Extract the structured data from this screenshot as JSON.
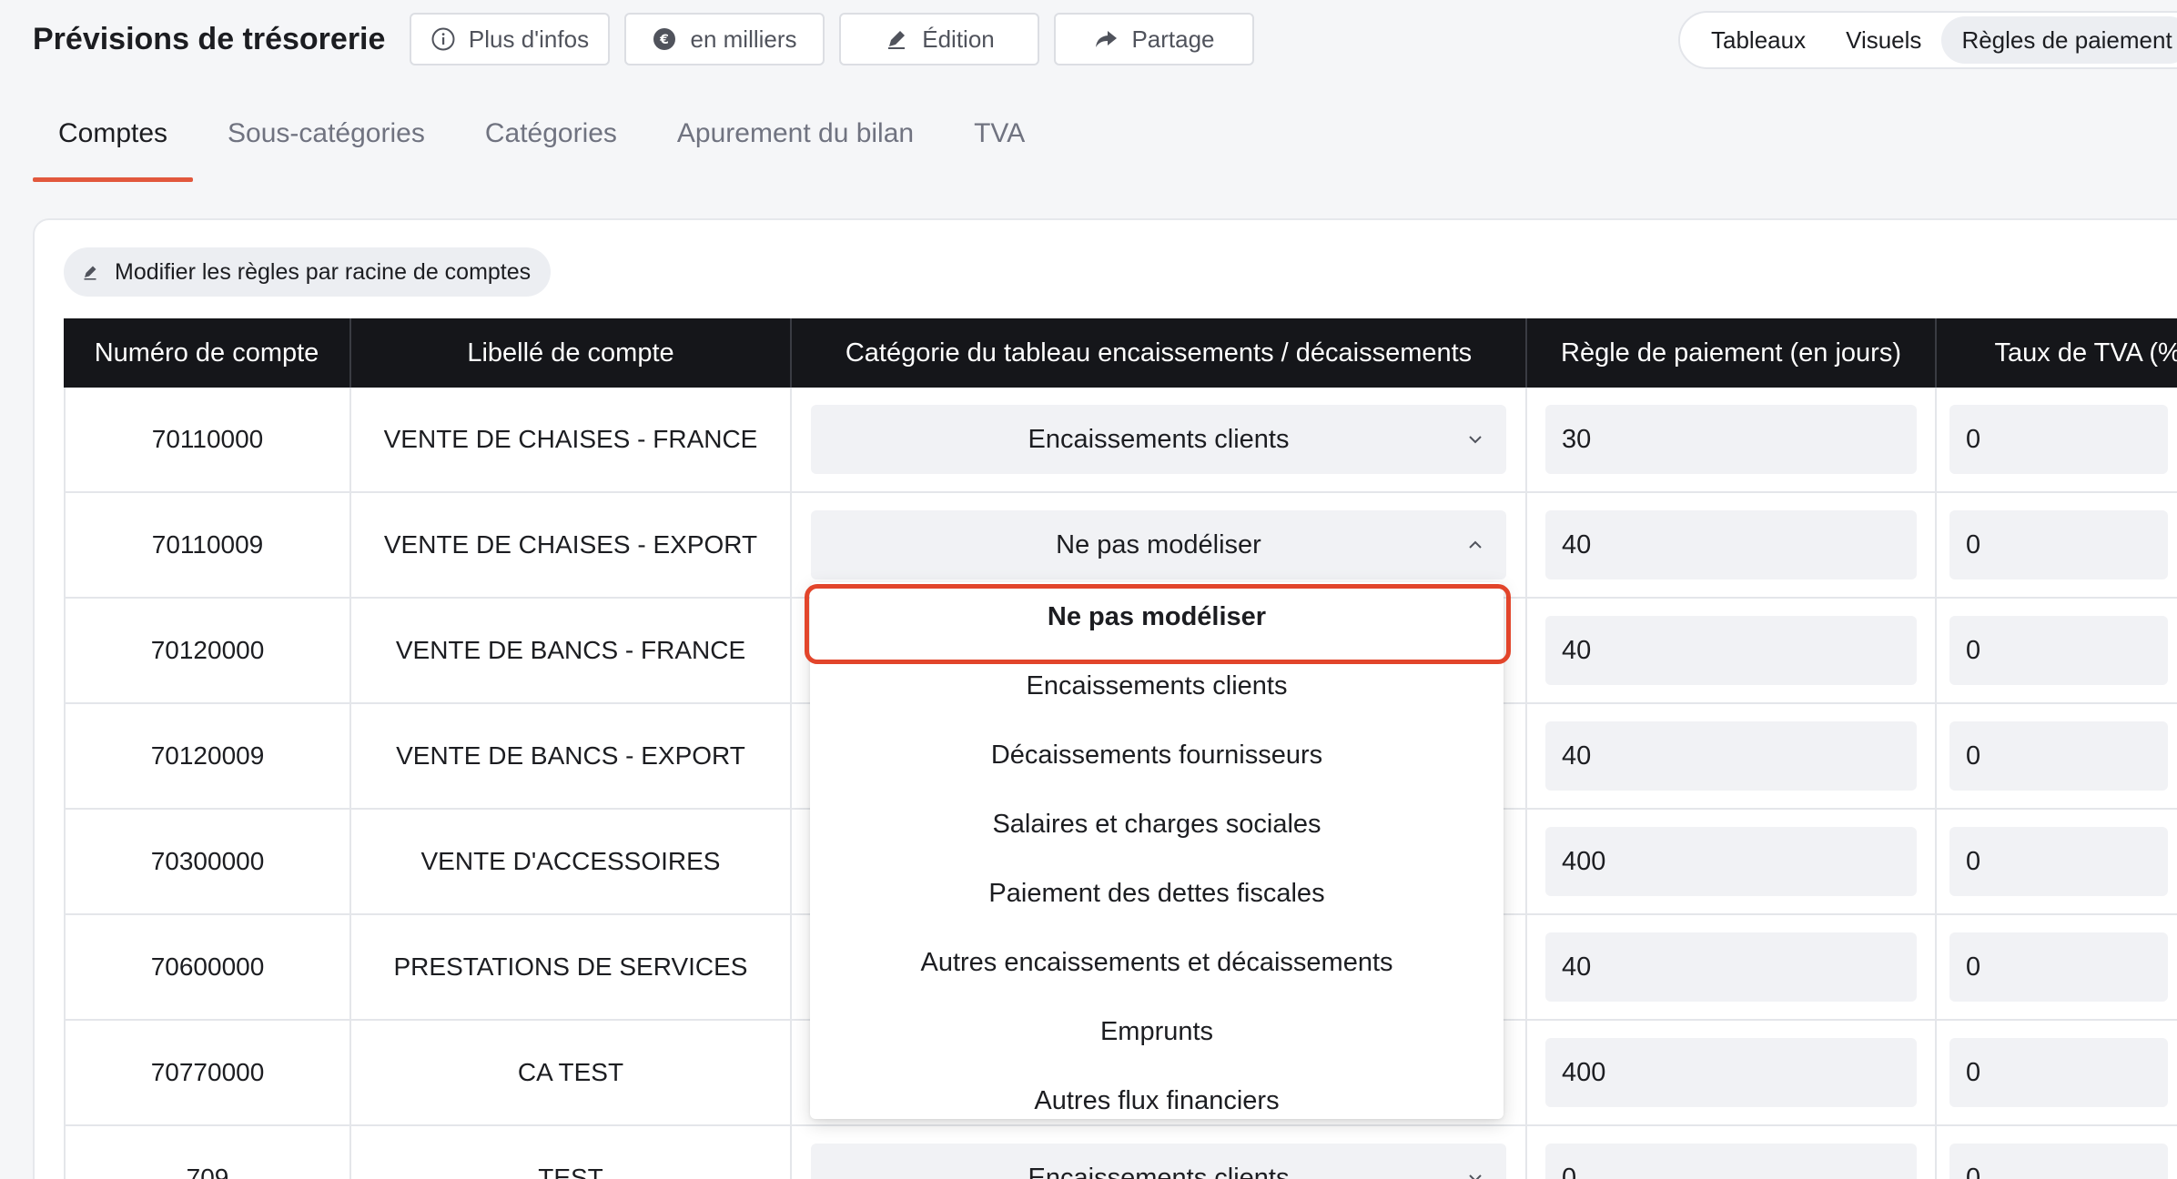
{
  "header": {
    "title": "Prévisions de trésorerie",
    "buttons": [
      {
        "label": "Plus d'infos",
        "icon": "info-icon"
      },
      {
        "label": "en milliers",
        "icon": "currency-icon"
      },
      {
        "label": "Édition",
        "icon": "pencil-icon"
      },
      {
        "label": "Partage",
        "icon": "share-icon"
      }
    ],
    "views": [
      {
        "label": "Tableaux"
      },
      {
        "label": "Visuels"
      },
      {
        "label": "Règles de paiement"
      }
    ]
  },
  "tabs": [
    {
      "label": "Comptes"
    },
    {
      "label": "Sous-catégories"
    },
    {
      "label": "Catégories"
    },
    {
      "label": "Apurement du bilan"
    },
    {
      "label": "TVA"
    }
  ],
  "chip": {
    "label": "Modifier les règles par racine de comptes",
    "icon": "pencil-icon"
  },
  "table": {
    "headers": [
      "Numéro de compte",
      "Libellé de compte",
      "Catégorie du tableau encaissements / décaissements",
      "Règle de paiement (en jours)",
      "Taux de TVA (%)"
    ],
    "rows": [
      {
        "num": "70110000",
        "label": "VENTE DE CHAISES - FRANCE",
        "cat": "Encaissements clients",
        "rule": "30",
        "tva": "0"
      },
      {
        "num": "70110009",
        "label": "VENTE DE CHAISES - EXPORT",
        "cat": "Ne pas modéliser",
        "rule": "40",
        "tva": "0"
      },
      {
        "num": "70120000",
        "label": "VENTE DE BANCS - FRANCE",
        "cat": "",
        "rule": "40",
        "tva": "0"
      },
      {
        "num": "70120009",
        "label": "VENTE DE BANCS - EXPORT",
        "cat": "",
        "rule": "40",
        "tva": "0"
      },
      {
        "num": "70300000",
        "label": "VENTE D'ACCESSOIRES",
        "cat": "",
        "rule": "400",
        "tva": "0"
      },
      {
        "num": "70600000",
        "label": "PRESTATIONS DE SERVICES",
        "cat": "",
        "rule": "40",
        "tva": "0"
      },
      {
        "num": "70770000",
        "label": "CA TEST",
        "cat": "",
        "rule": "400",
        "tva": "0"
      },
      {
        "num": "709",
        "label": "TEST",
        "cat": "Encaissements clients",
        "rule": "0",
        "tva": "0"
      }
    ]
  },
  "dropdown": {
    "options": [
      "Ne pas modéliser",
      "Encaissements clients",
      "Décaissements fournisseurs",
      "Salaires et charges sociales",
      "Paiement des dettes fiscales",
      "Autres encaissements et décaissements",
      "Emprunts",
      "Autres flux financiers"
    ],
    "selected": "Ne pas modéliser"
  },
  "colors": {
    "accent": "#e2583d",
    "highlight": "#e2452b",
    "header_bg": "#15161a"
  }
}
